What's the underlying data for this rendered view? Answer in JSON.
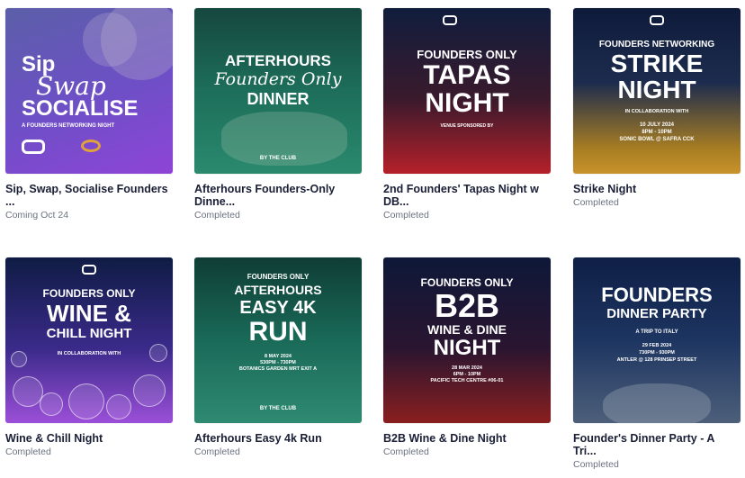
{
  "events": [
    {
      "title": "Sip, Swap, Socialise Founders ...",
      "status": "Coming Oct 24",
      "poster": {
        "lines": [
          "Sip",
          "Swap",
          "SOCIALISE",
          "A FOUNDERS NETWORKING NIGHT"
        ]
      }
    },
    {
      "title": "Afterhours Founders-Only Dinne...",
      "status": "Completed",
      "poster": {
        "lines": [
          "AFTERHOURS",
          "Founders Only",
          "DINNER",
          "BY THE CLUB"
        ]
      }
    },
    {
      "title": "2nd Founders' Tapas Night w DB...",
      "status": "Completed",
      "poster": {
        "lines": [
          "FOUNDERS ONLY",
          "TAPAS",
          "NIGHT",
          "VENUE SPONSORED BY"
        ]
      }
    },
    {
      "title": "Strike Night",
      "status": "Completed",
      "poster": {
        "lines": [
          "FOUNDERS NETWORKING",
          "STRIKE",
          "NIGHT",
          "IN COLLABORATION WITH",
          "10 JULY 2024",
          "8PM - 10PM",
          "SONIC BOWL @ SAFRA CCK"
        ]
      }
    },
    {
      "title": "Wine & Chill Night",
      "status": "Completed",
      "poster": {
        "lines": [
          "FOUNDERS ONLY",
          "WINE &",
          "CHILL NIGHT",
          "IN COLLABORATION WITH"
        ]
      }
    },
    {
      "title": "Afterhours Easy 4k Run",
      "status": "Completed",
      "poster": {
        "lines": [
          "FOUNDERS ONLY",
          "AFTERHOURS",
          "EASY 4K",
          "RUN",
          "8 MAY 2024",
          "530PM - 730PM",
          "BOTANICS GARDEN MRT EXIT A",
          "BY THE CLUB"
        ]
      }
    },
    {
      "title": "B2B Wine & Dine Night",
      "status": "Completed",
      "poster": {
        "lines": [
          "FOUNDERS ONLY",
          "B2B",
          "WINE & DINE",
          "NIGHT",
          "28 MAR 2024",
          "6PM - 10PM",
          "PACIFIC TECH CENTRE #06-01"
        ]
      }
    },
    {
      "title": "Founder's Dinner Party - A Tri...",
      "status": "Completed",
      "poster": {
        "lines": [
          "FOUNDERS",
          "DINNER PARTY",
          "A TRIP TO ITALY",
          "29 FEB 2024",
          "730PM - 930PM",
          "ANTLER @ 128 PRINSEP STREET"
        ]
      }
    }
  ]
}
